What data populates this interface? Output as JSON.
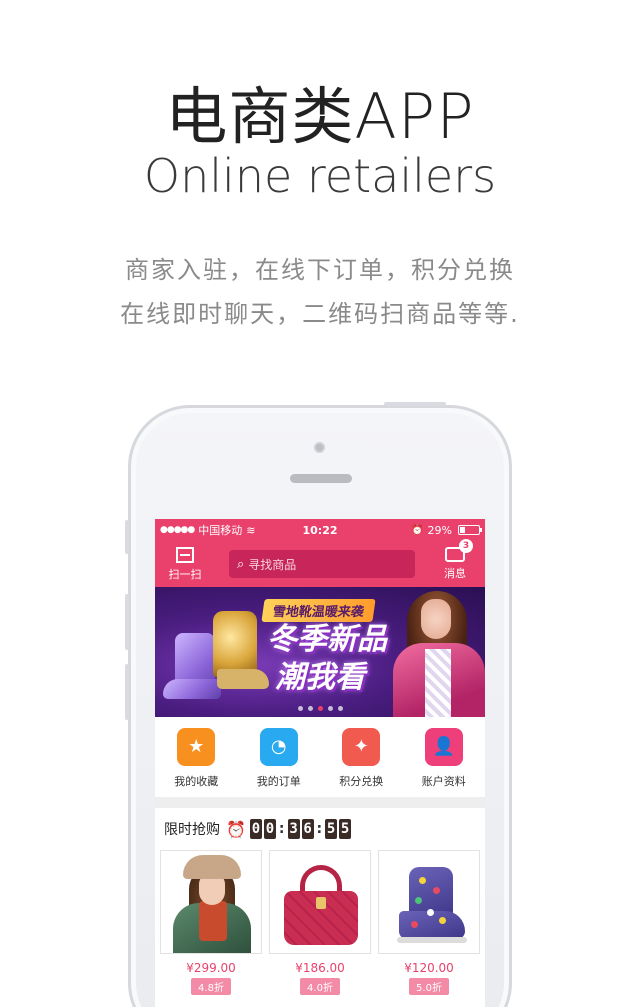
{
  "hero": {
    "title": "电商类APP",
    "subtitle": "Online retailers",
    "desc_line1": "商家入驻，在线下订单，积分兑换",
    "desc_line2": "在线即时聊天，二维码扫商品等等."
  },
  "statusbar": {
    "signal": "●●●●●",
    "carrier": "中国移动",
    "wifi": "≋",
    "time": "10:22",
    "alarm": "⏰",
    "battery": "29%"
  },
  "navbar": {
    "scan_label": "扫一扫",
    "search_placeholder": "寻找商品",
    "message_label": "消息",
    "message_count": "3"
  },
  "banner": {
    "tag": "雪地靴温暖来袭",
    "headline_1": "冬季新品",
    "headline_2": "潮我看",
    "pages": 5,
    "active_page": 2
  },
  "quick_menu": [
    {
      "label": "我的收藏",
      "color": "#f7901e",
      "icon": "star-bookmark-icon"
    },
    {
      "label": "我的订单",
      "color": "#29aaf0",
      "icon": "pie-chart-icon"
    },
    {
      "label": "积分兑换",
      "color": "#f15a4f",
      "icon": "wand-icon"
    },
    {
      "label": "账户资料",
      "color": "#ee3f7a",
      "icon": "user-icon"
    }
  ],
  "flash_sale": {
    "title": "限时抢购",
    "timer": [
      "0",
      "0",
      "3",
      "6",
      "5",
      "5"
    ],
    "products": [
      {
        "price": "¥299.00",
        "discount": "4.8折",
        "image": "woman-coat"
      },
      {
        "price": "¥186.00",
        "discount": "4.0折",
        "image": "red-handbag"
      },
      {
        "price": "¥120.00",
        "discount": "5.0折",
        "image": "purple-boot"
      }
    ]
  },
  "colors": {
    "brand": "#e9416c"
  }
}
